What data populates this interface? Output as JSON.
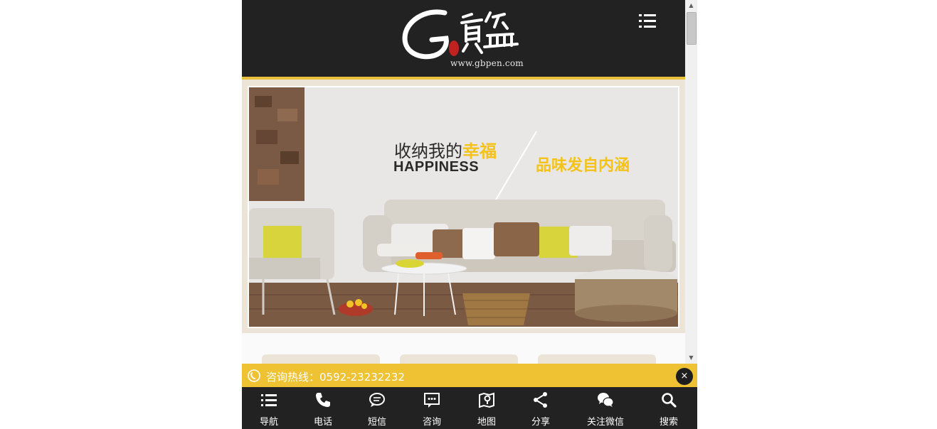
{
  "header": {
    "logo_url_text": "www.gbpen.com"
  },
  "banner": {
    "slogan_cn_prefix": "收纳我的",
    "slogan_cn_highlight": "幸福",
    "slogan_en": "HAPPINESS",
    "slogan_right": "品味发自内涵"
  },
  "hotline": {
    "text": "咨询热线：0592-23232232",
    "close_label": "×"
  },
  "nav": {
    "items": [
      {
        "label": "导航",
        "icon": "list-icon"
      },
      {
        "label": "电话",
        "icon": "phone-icon"
      },
      {
        "label": "短信",
        "icon": "message-icon"
      },
      {
        "label": "咨询",
        "icon": "chat-icon"
      },
      {
        "label": "地图",
        "icon": "map-icon"
      },
      {
        "label": "分享",
        "icon": "share-icon"
      },
      {
        "label": "关注微信",
        "icon": "wechat-icon"
      },
      {
        "label": "搜索",
        "icon": "search-icon"
      }
    ]
  },
  "scrollbar": {
    "up_glyph": "▲",
    "down_glyph": "▼"
  },
  "colors": {
    "header_bg": "#222222",
    "accent": "#eec232",
    "highlight_text": "#f4c21b"
  }
}
